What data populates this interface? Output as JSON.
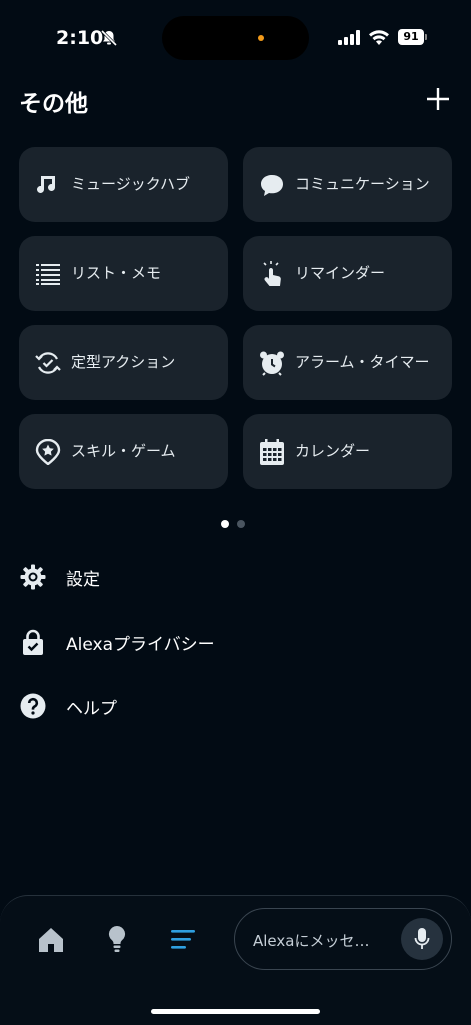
{
  "status_bar": {
    "time": "2:10",
    "battery": "91"
  },
  "header": {
    "title": "その他"
  },
  "tiles": [
    {
      "label": "ミュージックハブ",
      "icon": "music-note-icon"
    },
    {
      "label": "コミュニケーション",
      "icon": "speech-bubble-icon"
    },
    {
      "label": "リスト・メモ",
      "icon": "list-icon"
    },
    {
      "label": "リマインダー",
      "icon": "tap-hand-icon"
    },
    {
      "label": "定型アクション",
      "icon": "routine-check-icon"
    },
    {
      "label": "アラーム・タイマー",
      "icon": "alarm-clock-icon"
    },
    {
      "label": "スキル・ゲーム",
      "icon": "skill-star-icon"
    },
    {
      "label": "カレンダー",
      "icon": "calendar-icon"
    }
  ],
  "menu": [
    {
      "label": "設定",
      "icon": "gear-icon"
    },
    {
      "label": "Alexaプライバシー",
      "icon": "privacy-lock-icon"
    },
    {
      "label": "ヘルプ",
      "icon": "help-icon"
    }
  ],
  "bottom_bar": {
    "message_placeholder": "Alexaにメッセ…",
    "active_tab": "more",
    "accent_color": "#2f9fe0"
  }
}
